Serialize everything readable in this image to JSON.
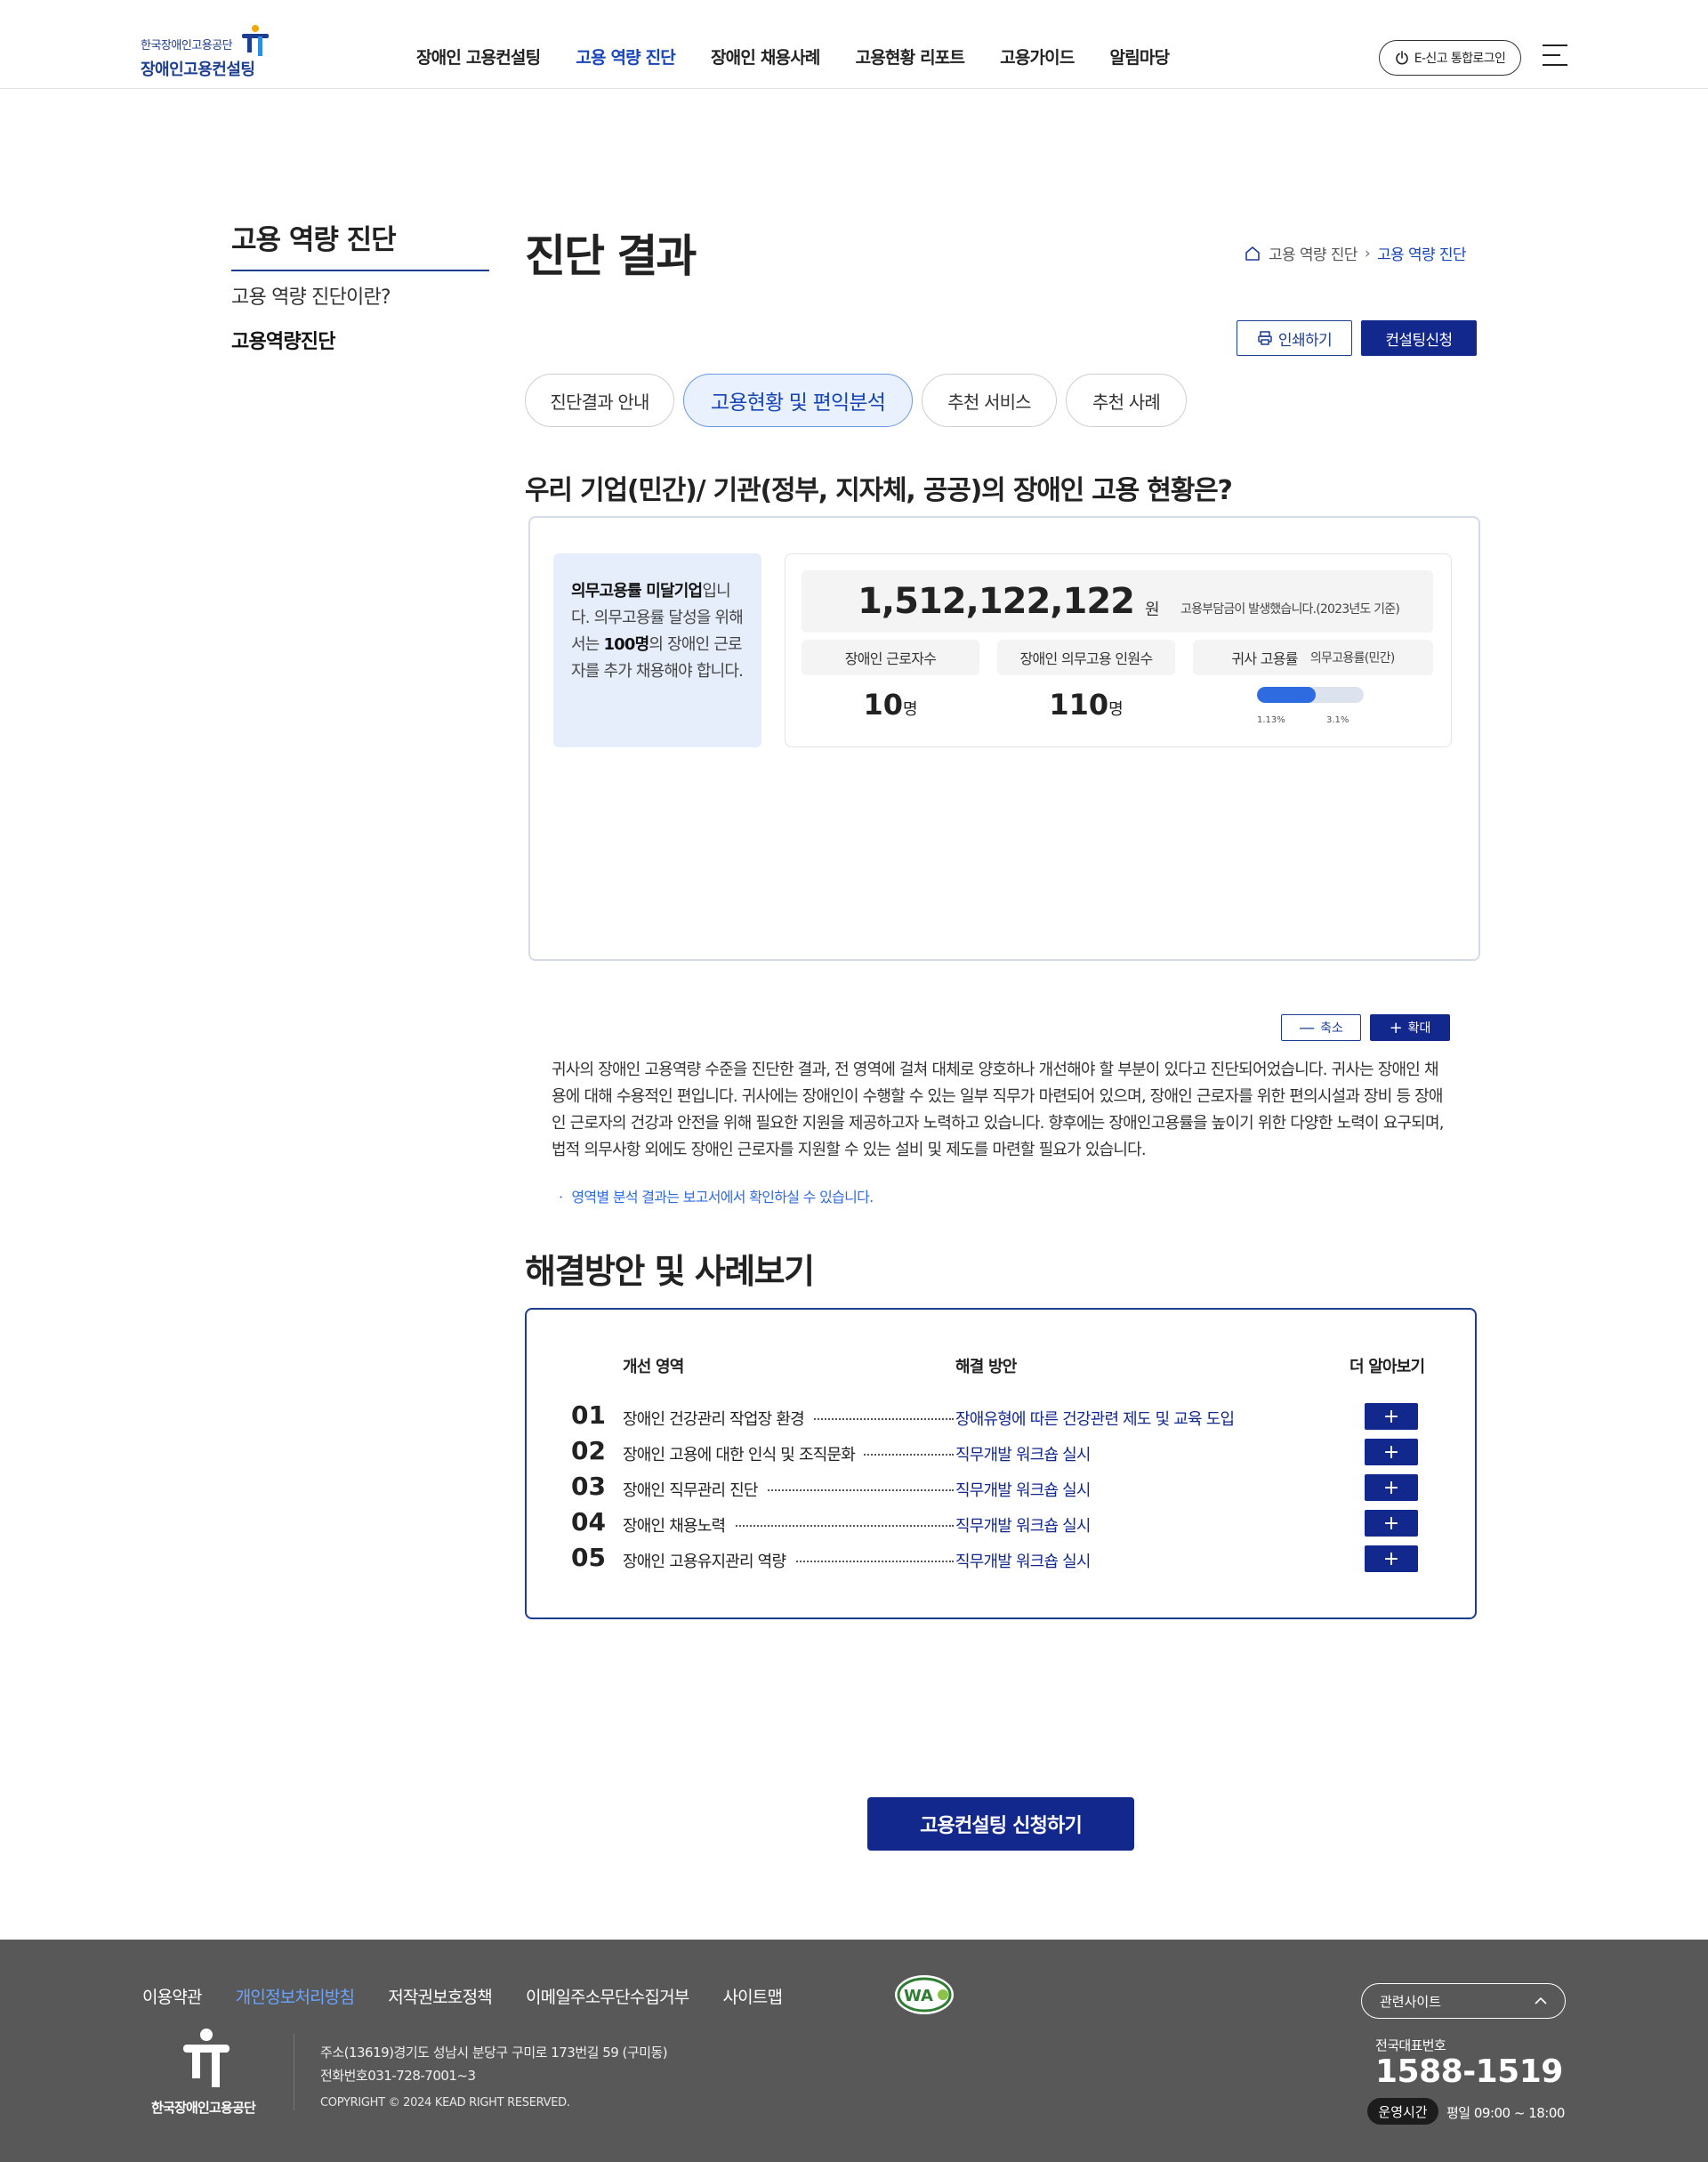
{
  "header": {
    "logo_small": "한국장애인고용공단",
    "logo_main": "장애인고용컨설팅",
    "nav": [
      {
        "label": "장애인 고용컨설팅",
        "active": false
      },
      {
        "label": "고용 역량 진단",
        "active": true
      },
      {
        "label": "장애인 채용사례",
        "active": false
      },
      {
        "label": "고용현황 리포트",
        "active": false
      },
      {
        "label": "고용가이드",
        "active": false
      },
      {
        "label": "알림마당",
        "active": false
      }
    ],
    "login_label": "E-신고 통합로그인",
    "accent_color": "#1745b8"
  },
  "lnb": {
    "title": "고용 역량 진단",
    "items": [
      "고용 역량 진단이란?",
      "고용역량진단"
    ]
  },
  "page": {
    "title": "진단 결과",
    "breadcrumb": [
      "고용 역량 진단",
      "고용 역량 진단"
    ],
    "print_label": "인쇄하기",
    "consult_label": "컨설팅신청"
  },
  "tabs": [
    {
      "label": "진단결과 안내",
      "active": false
    },
    {
      "label": "고용현황 및 편익분석",
      "active": true
    },
    {
      "label": "추천 서비스",
      "active": false
    },
    {
      "label": "추천 사례",
      "active": false
    }
  ],
  "status": {
    "question": "우리 기업(민간)/ 기관(정부, 지자체, 공공)의 장애인 고용 현황은?",
    "note_bold1": "의무고용률 미달기업",
    "note_text1": "입니다. 의무고용률 달성을 위해서는 ",
    "note_bold2": "100명",
    "note_text2": "의 장애인 근로자를 추가 채용해야 합니다.",
    "burden_amount": "1,512,122,122",
    "burden_unit": "원",
    "burden_note": "고용부담금이 발생했습니다.(2023년도 기준)",
    "workers_label": "장애인 근로자수",
    "workers_value": "10",
    "workers_unit": "명",
    "mandatory_label": "장애인 의무고용 인원수",
    "mandatory_value": "110",
    "mandatory_unit": "명",
    "ratio_label": "귀사 고용률",
    "ratio_sub": "의무고용률(민간)",
    "ratio_current": "1.13%",
    "ratio_required": "3.1%",
    "ratio_fill_fraction": 0.55
  },
  "zoom": {
    "out_label": "축소",
    "in_label": "확대"
  },
  "analysis": {
    "text": "귀사의 장애인 고용역량 수준을 진단한 결과, 전 영역에 걸쳐 대체로 양호하나 개선해야 할 부분이 있다고 진단되어었습니다. 귀사는 장애인 채용에 대해 수용적인 편입니다. 귀사에는 장애인이 수행할 수 있는 일부 직무가 마련되어 있으며, 장애인 근로자를 위한 편의시설과 장비 등 장애인 근로자의 건강과 안전을 위해 필요한 지원을 제공하고자 노력하고 있습니다. 향후에는 장애인고용률을 높이기 위한 다양한 노력이 요구되며, 법적 의무사항 외에도 장애인 근로자를 지원할 수 있는 설비 및 제도를 마련할 필요가 있습니다.",
    "note": "영역별 분석 결과는 보고서에서 확인하실 수 있습니다."
  },
  "solutions": {
    "title": "해결방안 및 사례보기",
    "col_area": "개선 영역",
    "col_solution": "해결 방안",
    "col_more": "더 알아보기",
    "rows": [
      {
        "num": "01",
        "area": "장애인 건강관리 작업장 환경",
        "solution": "장애유형에 따른 건강관련 제도 및 교육 도입"
      },
      {
        "num": "02",
        "area": "장애인 고용에 대한 인식 및 조직문화",
        "solution": "직무개발 워크숍 실시"
      },
      {
        "num": "03",
        "area": "장애인 직무관리 진단",
        "solution": "직무개발 워크숍 실시"
      },
      {
        "num": "04",
        "area": "장애인 채용노력",
        "solution": "직무개발 워크숍 실시"
      },
      {
        "num": "05",
        "area": "장애인 고용유지관리 역량",
        "solution": "직무개발 워크숍 실시"
      }
    ],
    "more_symbol": "+"
  },
  "apply_label": "고용컨설팅 신청하기",
  "footer": {
    "links": [
      {
        "label": "이용약관",
        "highlight": false
      },
      {
        "label": "개인정보처리방침",
        "highlight": true
      },
      {
        "label": "저작권보호정책",
        "highlight": false
      },
      {
        "label": "이메일주소무단수집거부",
        "highlight": false
      },
      {
        "label": "사이트맵",
        "highlight": false
      }
    ],
    "org_name": "한국장애인고용공단",
    "address": "주소(13619)경기도 성남시 분당구 구미로 173번길 59 (구미동)",
    "phone": "전화번호031-728-7001~3",
    "copyright": "COPYRIGHT © 2024 KEAD RIGHT RESERVED.",
    "related_label": "관련사이트",
    "tel_label": "전국대표번호",
    "tel_number": "1588-1519",
    "hours_label": "운영시간",
    "hours_text": "평일 09:00 ~ 18:00"
  }
}
